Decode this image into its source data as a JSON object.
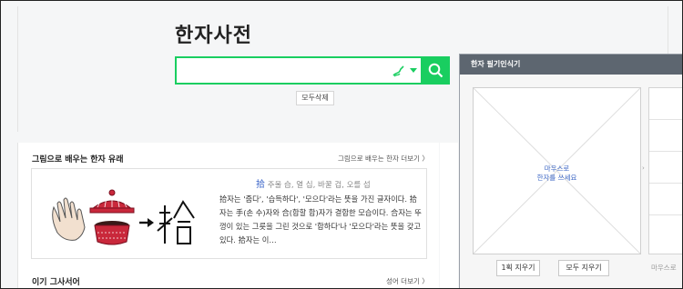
{
  "header": {
    "title": "한자사전",
    "search_placeholder": "",
    "clear_label": "모두삭제"
  },
  "history_card": {
    "heading": "그림으로 배우는 한자 유래",
    "more_link": "그림으로 배우는 한자 더보기 〉",
    "hanja_char": "拾",
    "hanja_readings": "주울 습, 열 십, 바꿀 겁, 오를 섭",
    "description": "拾자는 '줍다', '습득하다', '모으다'라는 뜻을 가진 글자이다. 拾자는 手(손 수)자와 合(합할 합)자가 결합한 모습이다. 合자는 뚜껑이 있는 그릇을 그린 것으로 '합하다'나 '모으다'라는 뜻을 갖고 있다. 拾자는 이…"
  },
  "idioms_card": {
    "heading": "이기 그사서어",
    "more_link": "성어 더보기 〉"
  },
  "handwriting_panel": {
    "title": "한자 필기인식기",
    "canvas_hint_line1": "마우스로",
    "canvas_hint_line2": "한자를 쓰세요",
    "undo_button": "1획 지우기",
    "clear_button": "모두 지우기",
    "side_hint": "마우스로"
  },
  "colors": {
    "accent_green": "#19ce60",
    "panel_header": "#5d6670",
    "link_blue": "#3b66c4"
  }
}
